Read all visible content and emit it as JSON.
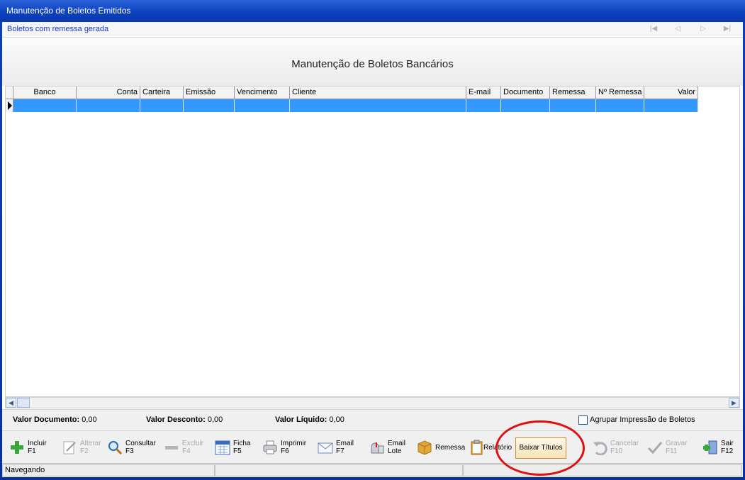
{
  "window": {
    "title": "Manutenção de Boletos Emitidos"
  },
  "subbar": {
    "subtitle": "Boletos com remessa gerada",
    "nav": [
      "first-icon",
      "prev-icon",
      "next-icon",
      "last-icon"
    ]
  },
  "page": {
    "title": "Manutenção de Boletos Bancários"
  },
  "grid": {
    "columns": [
      "Banco",
      "Conta",
      "Carteira",
      "Emissão",
      "Vencimento",
      "Cliente",
      "E-mail",
      "Documento",
      "Remessa",
      "Nº Remessa",
      "Valor"
    ],
    "rows": [
      [
        "",
        "",
        "",
        "",
        "",
        "",
        "",
        "",
        "",
        "",
        ""
      ]
    ]
  },
  "totals": {
    "doc_label": "Valor Documento:",
    "doc_value": "0,00",
    "desc_label": "Valor Desconto:",
    "desc_value": "0,00",
    "liq_label": "Valor Líquido:",
    "liq_value": "0,00"
  },
  "options": {
    "agrupar_label": "Agrupar Impressão de Boletos"
  },
  "toolbar": {
    "incluir": "Incluir",
    "incluir_key": "F1",
    "alterar": "Alterar",
    "alterar_key": "F2",
    "consultar": "Consultar",
    "consultar_key": "F3",
    "excluir": "Excluir",
    "excluir_key": "F4",
    "ficha": "Ficha",
    "ficha_key": "F5",
    "imprimir": "Imprimir",
    "imprimir_key": "F6",
    "email": "Email",
    "email_key": "F7",
    "email_lote_1": "Email",
    "email_lote_2": "Lote",
    "remessa": "Remessa",
    "relatorio": "Relatório",
    "baixar": "Baixar Títulos",
    "cancelar": "Cancelar",
    "cancelar_key": "F10",
    "gravar": "Gravar",
    "gravar_key": "F11",
    "sair": "Sair",
    "sair_key": "F12"
  },
  "status": {
    "mode": "Navegando"
  },
  "colors": {
    "selection": "#3399ff",
    "highlight_circle": "#e01010",
    "titlebar": "#0b3fbe"
  }
}
